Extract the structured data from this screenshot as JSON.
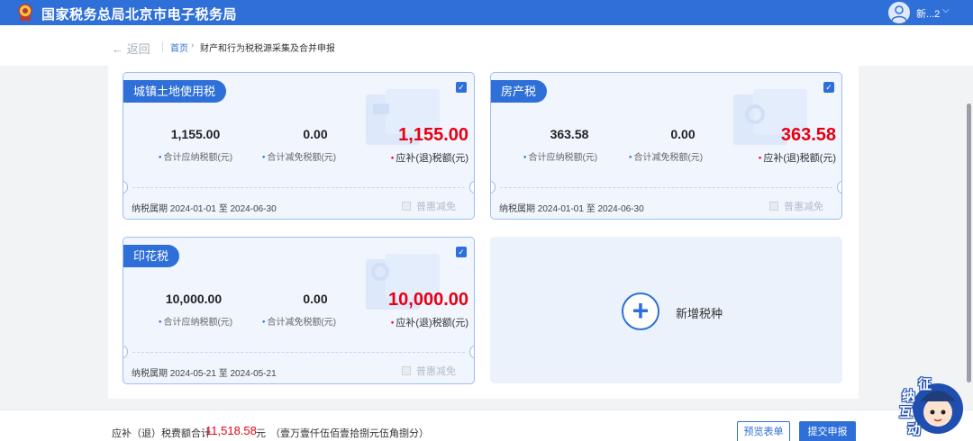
{
  "header": {
    "title": "国家税务总局北京市电子税务局",
    "user_name": "新...2",
    "user_caret": "⌵"
  },
  "breadcrumb": {
    "back": "← 返回",
    "home": "首页",
    "separator": "›",
    "current": "财产和行为税税源采集及合并申报"
  },
  "cards": [
    {
      "name": "城镇土地使用税",
      "payable": "1,155.00",
      "payable_label": "合计应纳税额(元)",
      "reduction": "0.00",
      "reduction_label": "合计减免税额(元)",
      "due": "1,155.00",
      "due_label": "应补(退)税额(元)",
      "period": "纳税属期 2024-01-01 至 2024-06-30",
      "relief": "普惠减免",
      "checked": true
    },
    {
      "name": "房产税",
      "payable": "363.58",
      "payable_label": "合计应纳税额(元)",
      "reduction": "0.00",
      "reduction_label": "合计减免税额(元)",
      "due": "363.58",
      "due_label": "应补(退)税额(元)",
      "period": "纳税属期 2024-01-01 至 2024-06-30",
      "relief": "普惠减免",
      "checked": true
    },
    {
      "name": "印花税",
      "payable": "10,000.00",
      "payable_label": "合计应纳税额(元)",
      "reduction": "0.00",
      "reduction_label": "合计减免税额(元)",
      "due": "10,000.00",
      "due_label": "应补(退)税额(元)",
      "period": "纳税属期 2024-05-21 至 2024-05-21",
      "relief": "普惠减免",
      "checked": true
    }
  ],
  "add_card": {
    "label": "新增税种",
    "icon": "plus-icon"
  },
  "footer": {
    "total_label": "应补（退）税费额合计",
    "total_amount": "11,518.58",
    "total_unit": "元",
    "total_words": "（壹万壹仟伍佰壹拾捌元伍角捌分）",
    "preview_button": "预览表单",
    "submit_button": "提交申报"
  },
  "mascot": {
    "chars": [
      "征",
      "纳",
      "互",
      "动"
    ]
  },
  "colors": {
    "brand": "#2e6fd8",
    "amount_red": "#e60012",
    "card_bg": "#f0f5fe"
  }
}
